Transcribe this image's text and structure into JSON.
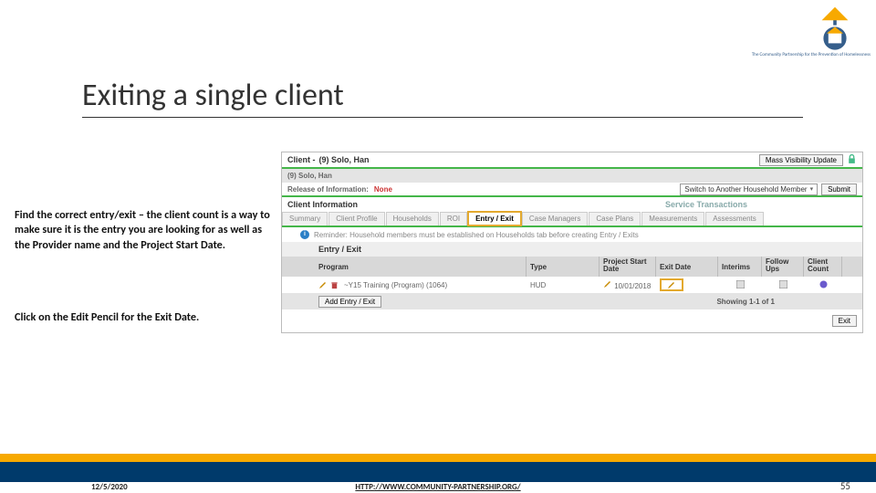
{
  "logo": {
    "caption": "The Community Partnership\nfor the Prevention\nof Homelessness"
  },
  "title": "Exiting a single client",
  "instructions": {
    "para1": "Find the correct entry/exit – the client count is a way to make sure it is the entry you are looking for as well as the Provider name and the Project Start Date.",
    "para2": "Click on the Edit Pencil for the Exit Date."
  },
  "shot": {
    "client_label": "Client -",
    "client_name": "(9) Solo, Han",
    "mass_btn": "Mass Visibility Update",
    "subbar_name": "(9) Solo, Han",
    "release_label": "Release of Information:",
    "release_value": "None",
    "switch_label": "Switch to Another Household Member",
    "submit": "Submit",
    "info_heading": "Client Information",
    "service_heading": "Service Transactions",
    "tabs": [
      "Summary",
      "Client Profile",
      "Households",
      "ROI",
      "Entry / Exit",
      "Case Managers",
      "Case Plans",
      "Measurements",
      "Assessments"
    ],
    "reminder": "Reminder: Household members must be established on Households tab before creating Entry / Exits",
    "section": "Entry / Exit",
    "cols": {
      "program": "Program",
      "type": "Type",
      "start1": "Project Start",
      "start2": "Date",
      "exit": "Exit Date",
      "interims": "Interims",
      "fu1": "Follow",
      "fu2": "Ups",
      "cnt1": "Client",
      "cnt2": "Count"
    },
    "row": {
      "program": "~Y15 Training (Program) (1064)",
      "type": "HUD",
      "start": "10/01/2018"
    },
    "add_btn": "Add Entry / Exit",
    "showing": "Showing 1-1 of 1",
    "exit_btn": "Exit"
  },
  "footer": {
    "date": "12/5/2020",
    "link": "HTTP://WWW.COMMUNITY-PARTNERSHIP.ORG/",
    "page": "55"
  }
}
